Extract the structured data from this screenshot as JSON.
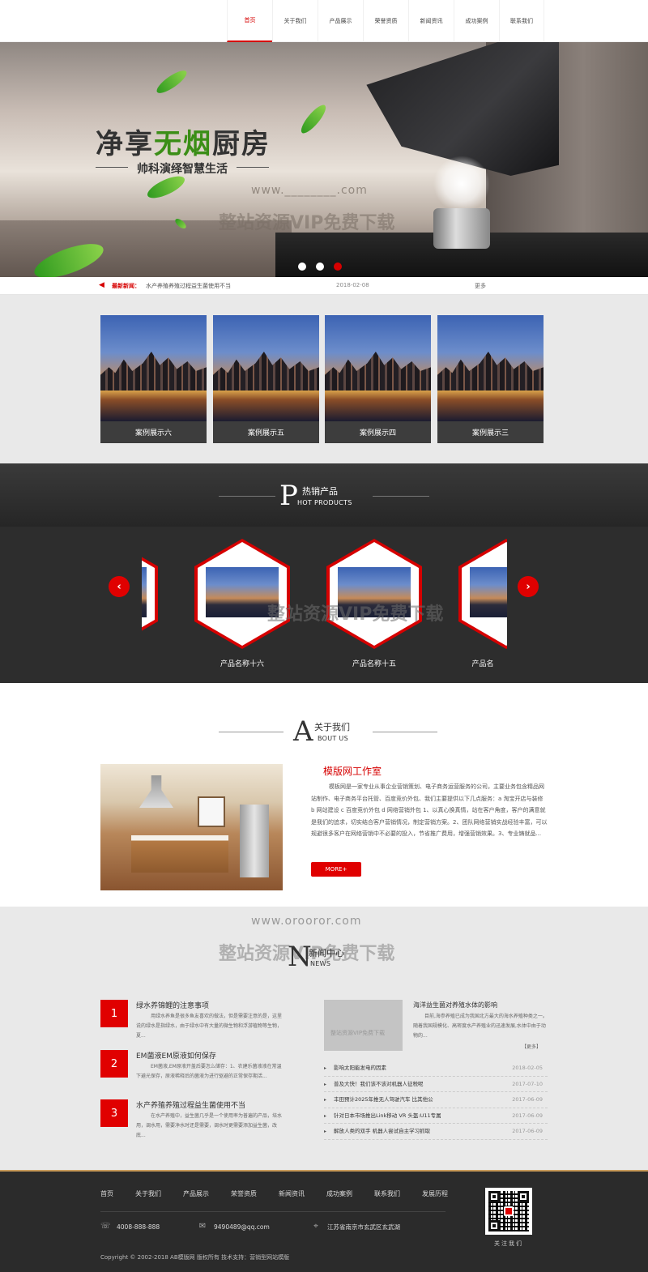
{
  "nav": {
    "items": [
      {
        "label": "首页",
        "active": true
      },
      {
        "label": "关于我们"
      },
      {
        "label": "产品展示"
      },
      {
        "label": "荣誉资质"
      },
      {
        "label": "新闻资讯"
      },
      {
        "label": "成功案例"
      },
      {
        "label": "联系我们"
      }
    ]
  },
  "banner": {
    "title_part1": "净享",
    "title_highlight": "无烟",
    "title_part2": "厨房",
    "subtitle": "帅科演绎智慧生活",
    "watermark_url": "www.________.com",
    "watermark_text": "整站资源VIP免费下载",
    "slide_count": 3,
    "active_slide": 3
  },
  "ticker": {
    "label": "最新新闻：",
    "text": "水产养殖养殖过程益生菌使用不当",
    "date": "2018-02-08",
    "more": "更多"
  },
  "cases": [
    {
      "label": "案例展示六"
    },
    {
      "label": "案例展示五"
    },
    {
      "label": "案例展示四"
    },
    {
      "label": "案例展示三"
    }
  ],
  "products": {
    "heading_letter": "P",
    "heading_cn": "热销产品",
    "heading_en": "HOT PRODUCTS",
    "items": [
      {
        "label": "产品名称十六"
      },
      {
        "label": "产品名称十五"
      },
      {
        "label": "产品名"
      }
    ],
    "prev_icon": "‹",
    "next_icon": "›",
    "watermark_text": "整站资源VIP免费下载"
  },
  "about": {
    "heading_letter": "A",
    "heading_cn": "关于我们",
    "heading_en": "BOUT US",
    "title": "模版网工作室",
    "text": "模板网是一家专业从事企业营销策划、电子商务运营服务的公司，主要业务包含精品网站制作、电子商务平台托管、百度竞价外包、我们主要提供以下几点服务：a 淘宝开店与装修 b 网站建设 c 百度竞价外包 d 网络营销外包 1、以真心换真情，站在客户角度，客户的满意就是我们的追求，切实结合客户营销情况，制定营销方案。2、团队网络营销实战经验丰富，可以规避很多客户在网络营销中不必要的投入，节省推广费用，增强营销效果。3、专业铸就品...",
    "more": "MORE+"
  },
  "news": {
    "heading_letter": "N",
    "heading_cn": "新闻中心",
    "heading_en": "NEWS",
    "watermark_url": "www.orooror.com",
    "watermark_text": "整站资源VIP免费下载",
    "featured_left": [
      {
        "num": "1",
        "title": "绿水养锦鲤的注意事项",
        "desc": "用绿水养鱼是很多鱼友喜欢的做法，但是需要注意的是，这里说的绿水是指绿水，由于绿水中有大量的微生物和浮游植物等生物，夏..."
      },
      {
        "num": "2",
        "title": "EM菌液EM原液如何保存",
        "desc": "EM菌液,EM原液开盖后要怎么储存：1、农建乐菌液液在常温下避光保存，原液稀释后的菌液为进行驱避的正常保存期活... "
      },
      {
        "num": "3",
        "title": "水产养殖养殖过程益生菌使用不当",
        "desc": "在水产养殖中，益生菌几乎是一个使用率为普遍的产品，培水用，调水用，需要净水时还是需要，调水时更需要添加益生菌，改底..."
      }
    ],
    "feature": {
      "title": "海洋益生菌对养殖水体的影响",
      "desc": "目前,海参养殖已成为我国北方最大的海水养殖种类之一。随着我国规模化、高密度水产养殖业的迅速发展,水体中由于动物的...",
      "more": "【更多】",
      "img_watermark": "整站资源VIP免费下载"
    },
    "list": [
      {
        "title": "影响太阳能发电的因素",
        "date": "2018-02-05"
      },
      {
        "title": "普及大快！我们该不该对机器人征税呢",
        "date": "2017-07-10"
      },
      {
        "title": "丰田预计2025年推无人驾驶汽车 比其他公",
        "date": "2017-06-09"
      },
      {
        "title": "针对日本市场推出Link移动 VR 头盔:U11专属",
        "date": "2017-06-09"
      },
      {
        "title": "解放人类的双手 机器人尝试自主学习抓取",
        "date": "2017-06-09"
      }
    ]
  },
  "footer": {
    "nav": [
      "首页",
      "关于我们",
      "产品展示",
      "荣誉资质",
      "新闻资讯",
      "成功案例",
      "联系我们",
      "发展历程"
    ],
    "phone": "4008-888-888",
    "email": "9490489@qq.com",
    "address": "江苏省南京市玄武区玄武湖",
    "copyright": "Copyright © 2002-2018 AB模版网 版权所有 技术支持：营销型网站模版",
    "qr_label": "关注我们"
  },
  "colors": {
    "accent": "#e00000",
    "dark": "#2d2d2d",
    "banner_green": "#3b8e17"
  }
}
